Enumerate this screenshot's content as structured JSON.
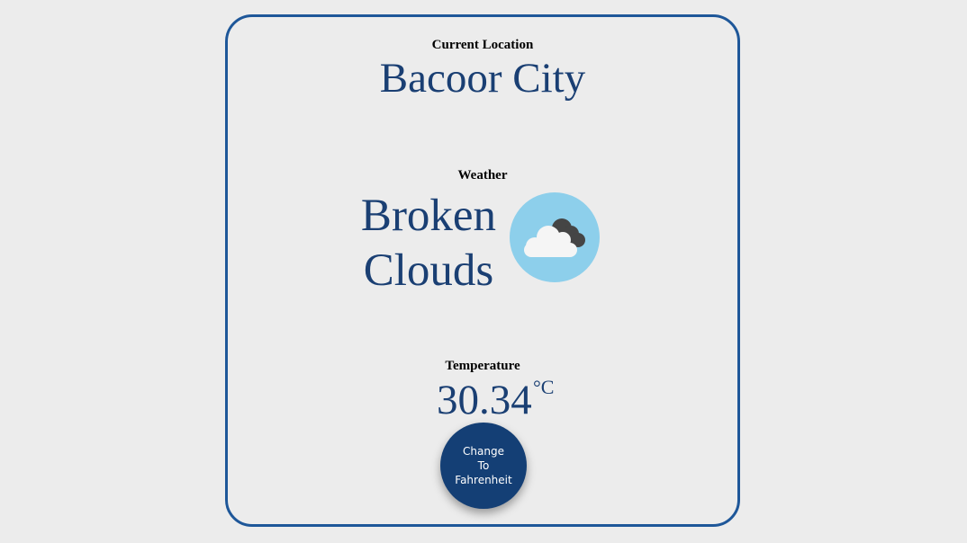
{
  "location": {
    "label": "Current Location",
    "city": "Bacoor City"
  },
  "weather": {
    "label": "Weather",
    "description": "Broken Clouds",
    "icon": "broken-clouds-icon"
  },
  "temperature": {
    "label": "Temperature",
    "value": "30.34",
    "unit": "°C"
  },
  "button": {
    "label": "Change\nTo\nFahrenheit"
  },
  "colors": {
    "background": "#ececec",
    "border": "#1e5799",
    "text_primary": "#1a3f73",
    "button_bg": "#143f75",
    "icon_bg": "#8dcfeb",
    "cloud_dark": "#454545",
    "cloud_light": "#f5f5f5"
  }
}
